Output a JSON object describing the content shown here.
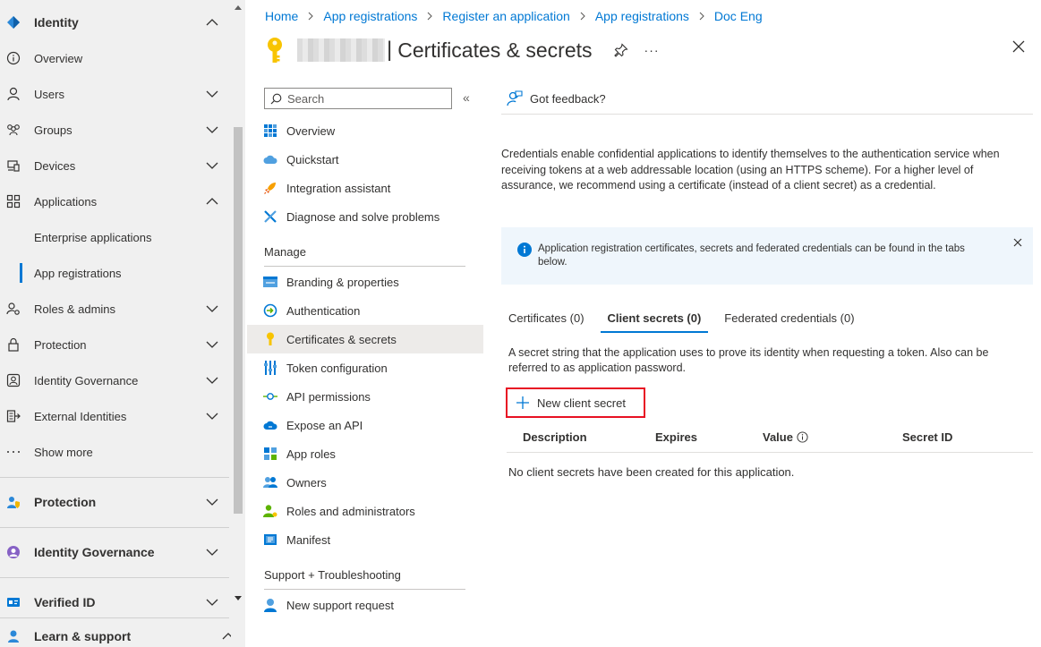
{
  "left_nav": {
    "items": [
      {
        "label": "Identity",
        "bold": true,
        "chevron": "up"
      },
      {
        "label": "Overview"
      },
      {
        "label": "Users",
        "chevron": "down"
      },
      {
        "label": "Groups",
        "chevron": "down"
      },
      {
        "label": "Devices",
        "chevron": "down"
      },
      {
        "label": "Applications",
        "chevron": "up"
      },
      {
        "label": "Enterprise applications",
        "sub": true
      },
      {
        "label": "App registrations",
        "sub": true,
        "selected": true
      },
      {
        "label": "Roles & admins",
        "chevron": "down"
      },
      {
        "label": "Protection",
        "chevron": "down"
      },
      {
        "label": "Identity Governance",
        "chevron": "down"
      },
      {
        "label": "External Identities",
        "chevron": "down"
      },
      {
        "label": "Show more"
      }
    ],
    "sections": [
      {
        "label": "Protection",
        "chevron": "down"
      },
      {
        "label": "Identity Governance",
        "chevron": "down"
      },
      {
        "label": "Verified ID",
        "chevron": "down"
      },
      {
        "label": "Learn & support",
        "chevron": "up"
      }
    ]
  },
  "breadcrumb": [
    "Home",
    "App registrations",
    "Register an application",
    "App registrations",
    "Doc Eng"
  ],
  "header": {
    "title_separator": "|",
    "title": "Certificates & secrets",
    "more": "···"
  },
  "resource_menu": {
    "search_placeholder": "Search",
    "collapse": "«",
    "top_items": [
      "Overview",
      "Quickstart",
      "Integration assistant",
      "Diagnose and solve problems"
    ],
    "manage_heading": "Manage",
    "manage_items": [
      "Branding & properties",
      "Authentication",
      "Certificates & secrets",
      "Token configuration",
      "API permissions",
      "Expose an API",
      "App roles",
      "Owners",
      "Roles and administrators",
      "Manifest"
    ],
    "support_heading": "Support + Troubleshooting",
    "support_items": [
      "New support request"
    ]
  },
  "content": {
    "feedback": "Got feedback?",
    "description": "Credentials enable confidential applications to identify themselves to the authentication service when receiving tokens at a web addressable location (using an HTTPS scheme). For a higher level of assurance, we recommend using a certificate (instead of a client secret) as a credential.",
    "info_banner": "Application registration certificates, secrets and federated credentials can be found in the tabs below.",
    "tabs": [
      {
        "label": "Certificates (0)",
        "active": false
      },
      {
        "label": "Client secrets (0)",
        "active": true
      },
      {
        "label": "Federated credentials (0)",
        "active": false
      }
    ],
    "tab_description": "A secret string that the application uses to prove its identity when requesting a token. Also can be referred to as application password.",
    "new_secret_label": "New client secret",
    "table_headers": [
      "Description",
      "Expires",
      "Value",
      "Secret ID"
    ],
    "empty_message": "No client secrets have been created for this application."
  },
  "colors": {
    "accent": "#0078d4",
    "highlight_border": "#e81123",
    "nav_bg": "#f0f0f0",
    "info_bg": "#eff6fc"
  }
}
